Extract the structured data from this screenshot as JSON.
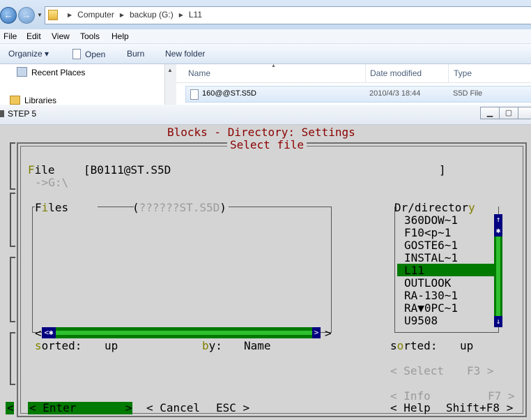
{
  "explorer": {
    "breadcrumb": [
      "Computer",
      "backup (G:)",
      "L11"
    ],
    "menu": [
      "File",
      "Edit",
      "View",
      "Tools",
      "Help"
    ],
    "toolbar": {
      "organize": "Organize ▾",
      "open": "Open",
      "burn": "Burn",
      "new_folder": "New folder"
    },
    "nav_items": [
      "Recent Places",
      "Libraries"
    ],
    "columns": [
      "Name",
      "Date modified",
      "Type"
    ],
    "file": {
      "name": "160@@ST.S5D",
      "date": "2010/4/3 18:44",
      "type": "S5D File"
    }
  },
  "step": {
    "window_title": "STEP 5",
    "title_line": "Blocks - Directory: Settings",
    "subtitle": "Select file",
    "file_label": "File",
    "file_value": "[B0111@ST.S5D",
    "file_close": "]",
    "path": "->G:\\",
    "files_label": "Files",
    "files_filter": "(??????ST.S5D)",
    "dir_label": "Dr/directory",
    "dirs": [
      "360DOW~1",
      "F10<p~1",
      "GOSTE6~1",
      "INSTAL~1",
      "L11",
      "OUTLOOK",
      "RA-130~1",
      "RA▼0PC~1",
      "U9508"
    ],
    "selected_dir_index": 4,
    "sorted_label": "sorted:",
    "sorted_value": "up",
    "by_label": "by:",
    "by_value": "Name",
    "dir_sorted_label": "sorted:",
    "dir_sorted_value": "up",
    "select_btn": "< Select",
    "select_key": "F3 >",
    "info_btn": "< Info",
    "info_key": "F7 >",
    "enter_btn": "< Enter",
    "enter_close": ">",
    "cancel_btn": "< Cancel",
    "cancel_key": "ESC >",
    "help_btn": "< Help",
    "help_key": "Shift+F8 >",
    "left_mark": "<"
  }
}
